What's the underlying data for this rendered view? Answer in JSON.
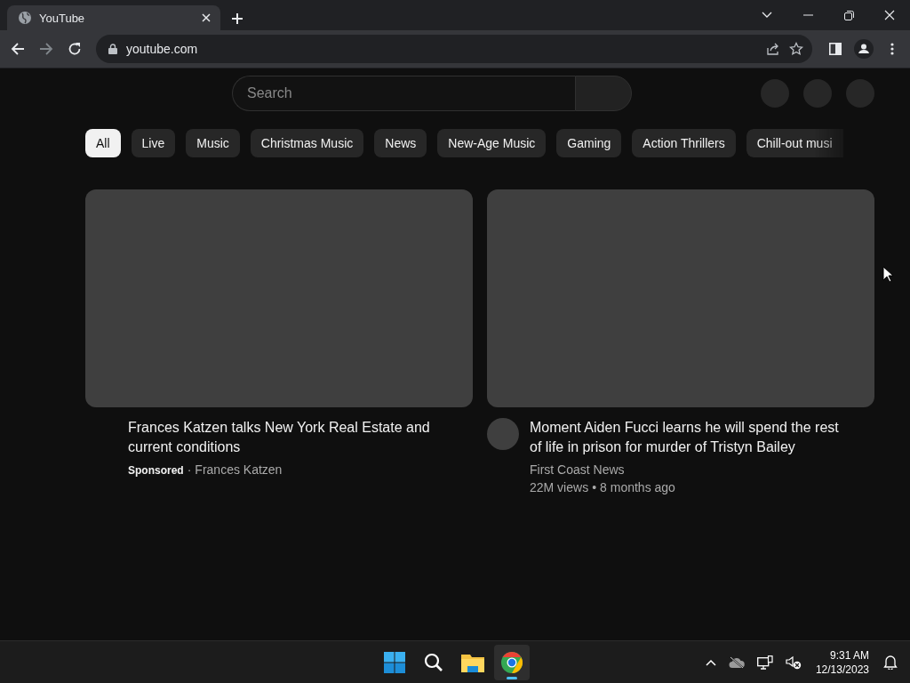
{
  "browser": {
    "tabs": [
      {
        "title": "YouTube",
        "selected": true
      }
    ],
    "address": "youtube.com"
  },
  "search": {
    "placeholder": "Search"
  },
  "chips": [
    {
      "label": "All",
      "selected": true
    },
    {
      "label": "Live",
      "selected": false
    },
    {
      "label": "Music",
      "selected": false
    },
    {
      "label": "Christmas Music",
      "selected": false
    },
    {
      "label": "News",
      "selected": false
    },
    {
      "label": "New-Age Music",
      "selected": false
    },
    {
      "label": "Gaming",
      "selected": false
    },
    {
      "label": "Action Thrillers",
      "selected": false
    },
    {
      "label": "Chill-out musi",
      "selected": false
    }
  ],
  "videos": [
    {
      "kind": "ad",
      "title": "Frances Katzen talks New York Real Estate and current conditions",
      "badge": "Sponsored",
      "separator": "·",
      "channel": "Frances Katzen"
    },
    {
      "kind": "video",
      "title": "Moment Aiden Fucci learns he will spend the rest of life in prison for murder of Tristyn Bailey",
      "channel": "First Coast News",
      "views": "22M views",
      "separator": "•",
      "age": "8 months ago"
    }
  ],
  "taskbar": {
    "apps": [
      {
        "kind": "start",
        "selected": false
      },
      {
        "kind": "search",
        "selected": false
      },
      {
        "kind": "files",
        "selected": false
      },
      {
        "kind": "browser",
        "selected": true
      }
    ],
    "time": "9:31 AM",
    "date": "12/13/2023"
  }
}
